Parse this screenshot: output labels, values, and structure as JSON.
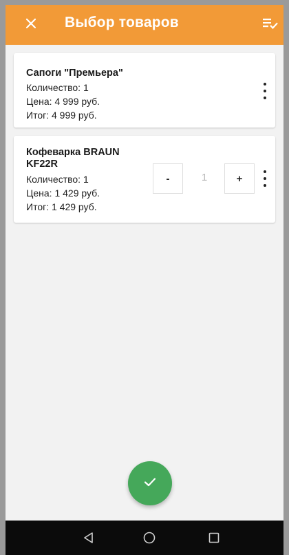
{
  "appbar": {
    "title": "Выбор товаров",
    "close_icon": "close-icon",
    "filter_icon": "filter-list-check-icon",
    "color": "#f29a37"
  },
  "items": [
    {
      "name": "Сапоги \"Премьера\"",
      "quantity": "Количество: 1",
      "price": "Цена: 4 999 руб.",
      "total": "Итог: 4 999 руб."
    },
    {
      "name": "Кофеварка BRAUN KF22R",
      "quantity": "Количество: 1",
      "price": "Цена: 1 429 руб.",
      "total": "Итог: 1 429 руб.",
      "stepper": {
        "minus_label": "-",
        "value": "1",
        "plus_label": "+"
      }
    }
  ],
  "fab": {
    "icon": "check-icon",
    "color": "#45a85a"
  },
  "navbar": {
    "icons": [
      "back-triangle-icon",
      "home-circle-icon",
      "recent-square-icon"
    ]
  }
}
